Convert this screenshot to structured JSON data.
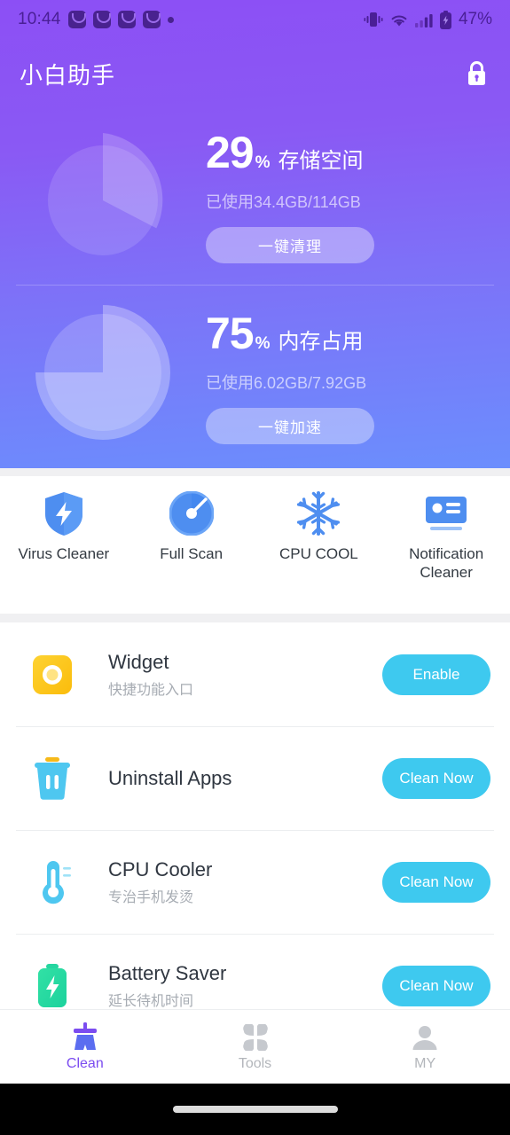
{
  "status_bar": {
    "time": "10:44",
    "notification_icons": [
      "message-icon",
      "message-icon",
      "message-icon",
      "message-icon"
    ],
    "overflow_dot": "more-notifications-dot",
    "right_icons": [
      "vibrate-icon",
      "wifi-icon",
      "signal-icon",
      "battery-charging-icon"
    ],
    "battery_text": "47%"
  },
  "app_bar": {
    "title": "小白助手",
    "lock_icon": "lock-icon"
  },
  "stats": [
    {
      "key": "storage",
      "percent": "29",
      "percent_sign": "%",
      "label": "存储空间",
      "used": "已使用34.4GB/114GB",
      "button": "一键清理",
      "pie_fraction": 0.29
    },
    {
      "key": "memory",
      "percent": "75",
      "percent_sign": "%",
      "label": "内存占用",
      "used": "已使用6.02GB/7.92GB",
      "button": "一键加速",
      "pie_fraction": 0.75
    }
  ],
  "quick_tools": [
    {
      "label": "Virus Cleaner",
      "icon": "shield-bolt-icon"
    },
    {
      "label": "Full Scan",
      "icon": "scan-gauge-icon"
    },
    {
      "label": "CPU COOL",
      "icon": "snowflake-icon"
    },
    {
      "label": "Notification Cleaner",
      "icon": "notification-card-icon"
    }
  ],
  "features": [
    {
      "title": "Widget",
      "subtitle": "快捷功能入口",
      "button": "Enable",
      "icon": "widget-icon"
    },
    {
      "title": "Uninstall Apps",
      "subtitle": "",
      "button": "Clean Now",
      "icon": "trash-icon"
    },
    {
      "title": "CPU Cooler",
      "subtitle": "专治手机发烫",
      "button": "Clean Now",
      "icon": "thermometer-icon"
    },
    {
      "title": "Battery Saver",
      "subtitle": "延长待机时间",
      "button": "Clean Now",
      "icon": "battery-bolt-icon"
    }
  ],
  "bottom_nav": [
    {
      "label": "Clean",
      "icon": "broom-icon",
      "active": true
    },
    {
      "label": "Tools",
      "icon": "grid-petals-icon",
      "active": false
    },
    {
      "label": "MY",
      "icon": "person-icon",
      "active": false
    }
  ],
  "colors": {
    "header_top": "#8c4ff5",
    "header_bottom": "#6b8efd",
    "accent_button": "#3ec9ef",
    "nav_active": "#7b4cf0",
    "page_bg": "#f0f0f2"
  }
}
